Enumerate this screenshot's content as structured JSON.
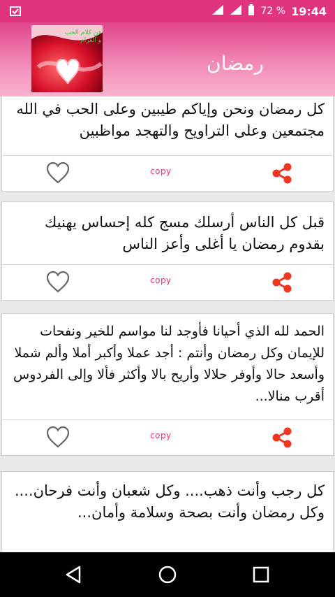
{
  "status_bar": {
    "battery": "72 %",
    "time": "19:44"
  },
  "app_bar": {
    "title": "رمضان",
    "logo_text": "فن كلام الحب و الغرام"
  },
  "actions": {
    "copy_label": "copy"
  },
  "cards": [
    {
      "text": "كل رمضان ونحن وإياكم طيبين وعلى الحب في الله مجتمعين وعلى التراويح والتهجد مواظبين"
    },
    {
      "text": "قبل كل الناس أرسلك مسج كله إحساس يهنيك بقدوم رمضان يا أغلى وأعز الناس"
    },
    {
      "text": "الحمد لله الذي أحيانا فأوجد لنا مواسم للخير ونفحات للإيمان وكل رمضان وأنتم : أجد عملا وأكبر أملا وألم شملا وأسعد حالا وأوفر حلالا وأريح بالا وأكثر فألا وإلى الفردوس أقرب منالا..."
    },
    {
      "text": "كل رجب وأنت ذهب.... وكل شعبان وأنت فرحان.... وكل رمضان وأنت بصحة وسلامة وأمان..."
    }
  ],
  "colors": {
    "accent": "#e0347f",
    "share": "#f0361f",
    "copy": "#e8326f"
  }
}
